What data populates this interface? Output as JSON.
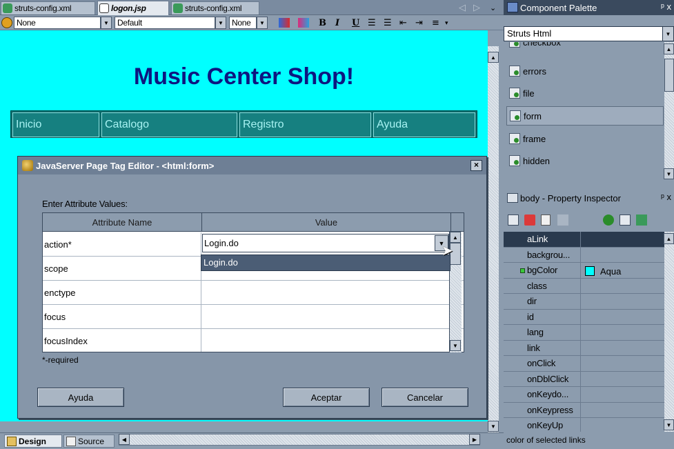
{
  "editor_tabs": [
    {
      "label": "struts-config.xml",
      "active": false
    },
    {
      "label": "logon.jsp",
      "active": true
    },
    {
      "label": "struts-config.xml",
      "active": false
    }
  ],
  "toolbar": {
    "style_combo": "None",
    "font_combo": "Default",
    "size_combo": "None",
    "bold": "B",
    "italic": "I",
    "underline": "U"
  },
  "page": {
    "title": "Music Center Shop!",
    "nav": [
      "Inicio",
      "Catalogo",
      "Registro",
      "Ayuda"
    ],
    "background_color": "#00FFFF"
  },
  "dialog": {
    "title": "JavaServer Page Tag Editor - <html:form>",
    "close": "×",
    "enter_label": "Enter Attribute Values:",
    "col_name": "Attribute Name",
    "col_value": "Value",
    "rows": [
      {
        "name": "action*",
        "value": "Login.do"
      },
      {
        "name": "scope",
        "value": ""
      },
      {
        "name": "enctype",
        "value": ""
      },
      {
        "name": "focus",
        "value": ""
      },
      {
        "name": "focusIndex",
        "value": ""
      }
    ],
    "dropdown_option": "Login.do",
    "required_note": "*-required",
    "btn_help": "Ayuda",
    "btn_ok": "Aceptar",
    "btn_cancel": "Cancelar"
  },
  "bottom_tabs": [
    {
      "label": "Design",
      "active": true
    },
    {
      "label": "Source",
      "active": false
    }
  ],
  "palette": {
    "title": "Component Palette",
    "pin": "ᵖ x",
    "category": "Struts Html",
    "items": [
      {
        "label": "checkbox",
        "selected": false
      },
      {
        "label": "errors",
        "selected": false
      },
      {
        "label": "file",
        "selected": false
      },
      {
        "label": "form",
        "selected": true
      },
      {
        "label": "frame",
        "selected": false
      },
      {
        "label": "hidden",
        "selected": false
      }
    ]
  },
  "inspector": {
    "title": "body - Property Inspector",
    "props": [
      {
        "name": "aLink",
        "value": "",
        "selected": true
      },
      {
        "name": "backgrou...",
        "value": ""
      },
      {
        "name": "bgColor",
        "value": "Aqua",
        "swatch": "#00FFFF",
        "marked": true
      },
      {
        "name": "class",
        "value": ""
      },
      {
        "name": "dir",
        "value": ""
      },
      {
        "name": "id",
        "value": ""
      },
      {
        "name": "lang",
        "value": ""
      },
      {
        "name": "link",
        "value": ""
      },
      {
        "name": "onClick",
        "value": ""
      },
      {
        "name": "onDblClick",
        "value": ""
      },
      {
        "name": "onKeydo...",
        "value": ""
      },
      {
        "name": "onKeypress",
        "value": ""
      },
      {
        "name": "onKeyUp",
        "value": ""
      }
    ],
    "status": "color of selected links"
  }
}
